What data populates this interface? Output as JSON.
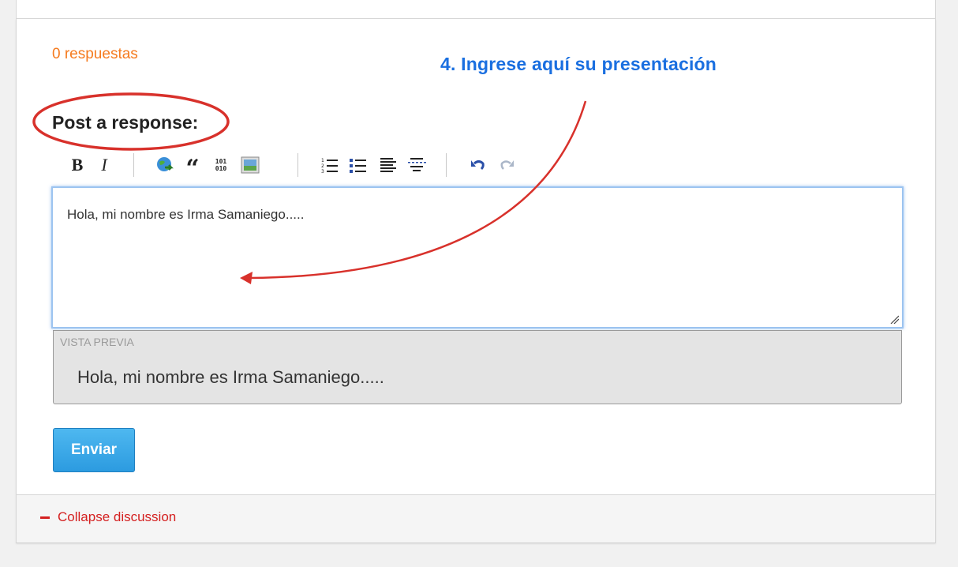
{
  "responses": {
    "count_label": "0 respuestas"
  },
  "annotation": {
    "text": "4. Ingrese aquí su presentación",
    "color": "#1a6fe0"
  },
  "form": {
    "title": "Post a response:",
    "editor_value": "Hola, mi nombre es Irma Samaniego.....",
    "preview_label": "VISTA PREVIA",
    "preview_text": "Hola, mi nombre es Irma Samaniego.....",
    "submit_label": "Enviar"
  },
  "toolbar": {
    "bold_glyph": "B",
    "italic_glyph": "I",
    "quote_glyph": "“",
    "code_glyph": "101\n010",
    "buttons": [
      "bold-icon",
      "italic-icon",
      "link-icon",
      "quote-icon",
      "code-icon",
      "image-icon",
      "ordered-list-icon",
      "bulleted-list-icon",
      "heading-icon",
      "horizontal-rule-icon",
      "undo-icon",
      "redo-icon"
    ]
  },
  "footer": {
    "collapse_label": "Collapse discussion"
  },
  "colors": {
    "accent_orange": "#f57b1f",
    "link_red": "#d42020",
    "submit_blue": "#2c9be0",
    "annotation_red": "#d8312b"
  }
}
